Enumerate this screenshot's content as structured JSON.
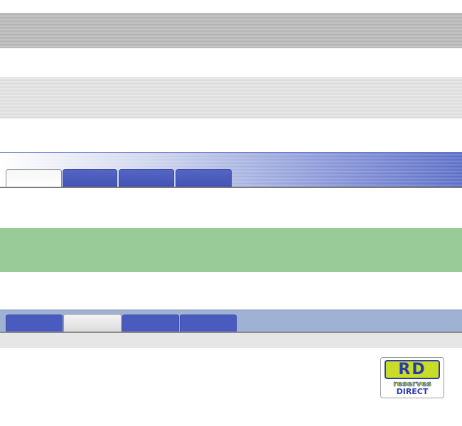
{
  "swatches": {
    "gray_dark": "#b8b8b8",
    "gray_light": "#e0e0e0",
    "green": "#98cb98",
    "periwinkle": "#a0b2d4"
  },
  "tabbar_1": {
    "accent": "#4253b3",
    "tabs": [
      {
        "label": "",
        "state": "active"
      },
      {
        "label": "",
        "state": "inactive"
      },
      {
        "label": "",
        "state": "inactive"
      },
      {
        "label": "",
        "state": "inactive"
      }
    ]
  },
  "tabbar_2": {
    "accent": "#4a5bc0",
    "tabs": [
      {
        "label": "",
        "state": "inactive"
      },
      {
        "label": "",
        "state": "active"
      },
      {
        "label": "",
        "state": "inactive"
      },
      {
        "label": "",
        "state": "inactive"
      }
    ]
  },
  "logo": {
    "initials": "RD",
    "line1": "reserves",
    "line2": "DIRECT",
    "colors": {
      "lime": "#c8dc28",
      "blue": "#2a3ca8"
    }
  }
}
